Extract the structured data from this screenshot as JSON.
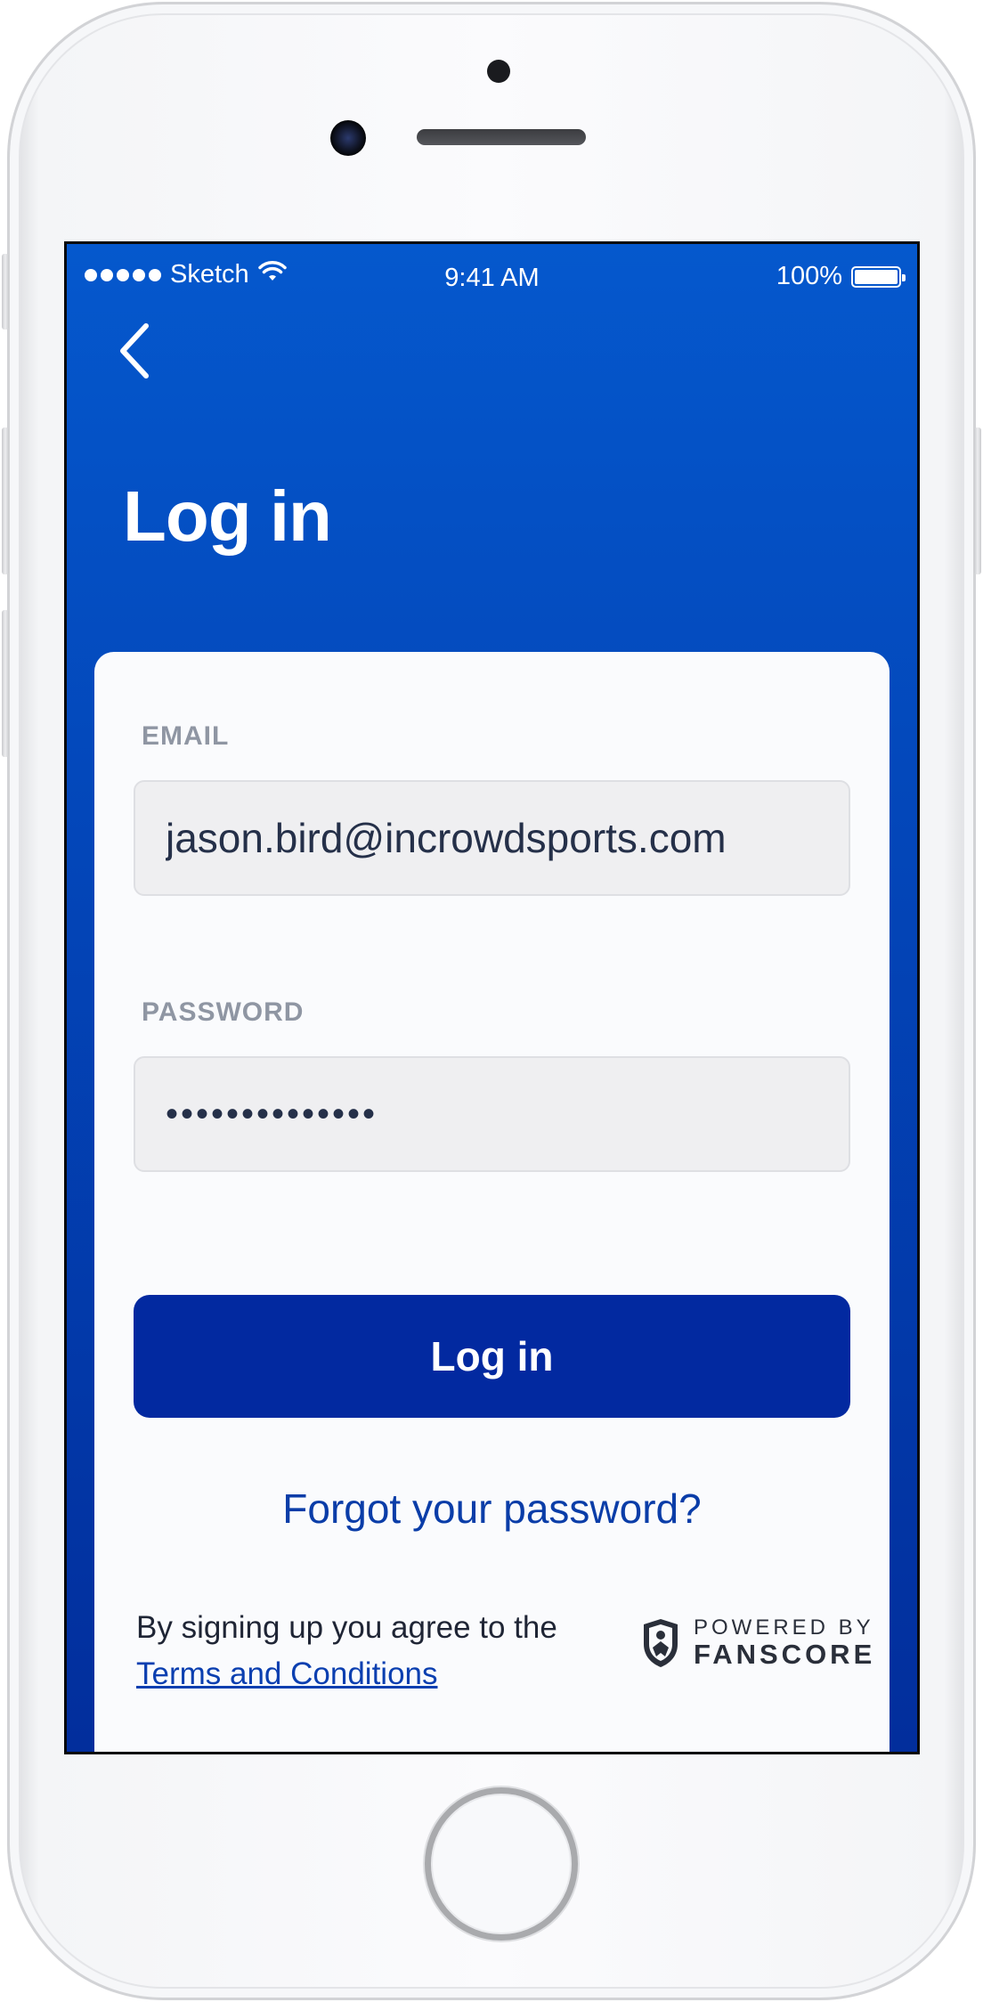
{
  "status_bar": {
    "carrier": "Sketch",
    "time": "9:41 AM",
    "battery": "100%"
  },
  "header": {
    "title": "Log in"
  },
  "form": {
    "email_label": "EMAIL",
    "email_value": "jason.bird@incrowdsports.com",
    "password_label": "PASSWORD",
    "password_value": "••••••••••••••",
    "login_button": "Log in",
    "forgot_link": "Forgot your password?"
  },
  "footer": {
    "terms_prefix": "By signing up you agree to the",
    "terms_link": "Terms and Conditions",
    "powered_by": "POWERED BY",
    "brand": "FANSCORE"
  },
  "icons": {
    "back": "chevron-left-icon",
    "wifi": "wifi-icon",
    "battery": "battery-icon",
    "brand_logo": "fanscore-shield-icon"
  },
  "colors": {
    "header_blue": "#0558cd",
    "button_blue": "#0229a0",
    "link_blue": "#0a3da8",
    "label_gray": "#8f96a3"
  }
}
